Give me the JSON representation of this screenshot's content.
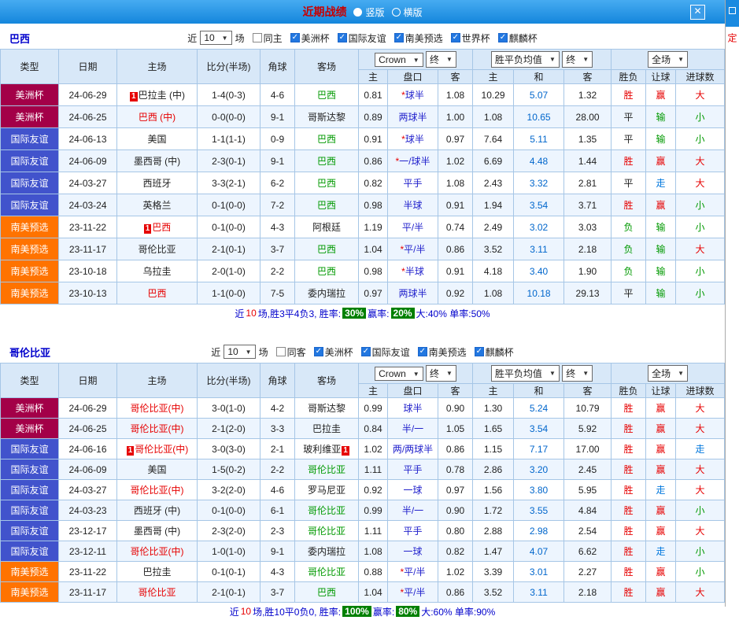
{
  "window": {
    "title": "近期战绩",
    "close": "✕",
    "views": [
      {
        "label": "竖版",
        "state": "on"
      },
      {
        "label": "横版",
        "state": "off"
      }
    ]
  },
  "side_strip": {
    "label": "定"
  },
  "icons": {
    "dropdown_arrow": "▼",
    "checkbox_check": "✓",
    "close": "✕"
  },
  "colors": {
    "accent_blue": "#1486dc",
    "type_copa": "#a30048",
    "type_friendly": "#4153cc",
    "type_sam_qual": "#ff7300",
    "win_red": "#e60000",
    "lose_green": "#009900",
    "push_blue": "#0077dd",
    "badge_green": "#008000"
  },
  "table_headers": {
    "cols": [
      "类型",
      "日期",
      "主场",
      "比分(半场)",
      "角球",
      "客场"
    ],
    "sub": [
      "主",
      "盘口",
      "客",
      "主",
      "和",
      "客",
      "胜负",
      "让球",
      "进球数"
    ]
  },
  "sections": [
    {
      "team": "巴西",
      "filter": {
        "near": "近",
        "count": "10",
        "games": "场",
        "checks": [
          {
            "label": "同主",
            "state": "off"
          },
          {
            "label": "美洲杯",
            "state": "on"
          },
          {
            "label": "国际友谊",
            "state": "on"
          },
          {
            "label": "南美预选",
            "state": "on"
          },
          {
            "label": "世界杯",
            "state": "on"
          },
          {
            "label": "麒麟杯",
            "state": "on"
          }
        ]
      },
      "dropdowns": {
        "source": "Crown",
        "time1": "终",
        "europe": "胜平负均值",
        "time2": "终",
        "scope": "全场"
      },
      "rows": [
        {
          "type": "美洲杯",
          "type_c": "t-copa",
          "date": "24-06-29",
          "hb": "1",
          "home": "巴拉圭 (中)",
          "home_c": "cK",
          "score": "1-4(0-3)",
          "corners": "4-6",
          "away": "巴西",
          "away_c": "cG",
          "o1": "0.81",
          "star": "*",
          "hcap": "球半",
          "o2": "1.08",
          "e1": "10.29",
          "e2": "5.07",
          "e3": "1.32",
          "res": "胜",
          "res_c": "cR",
          "cov": "赢",
          "cov_c": "cR",
          "ou": "大",
          "ou_c": "cR"
        },
        {
          "type": "美洲杯",
          "type_c": "t-copa",
          "date": "24-06-25",
          "home": "巴西 (中)",
          "home_c": "cR",
          "score": "0-0(0-0)",
          "corners": "9-1",
          "away": "哥斯达黎",
          "away_c": "cK",
          "o1": "0.89",
          "hcap": "两球半",
          "o2": "1.00",
          "e1": "1.08",
          "e2": "10.65",
          "e3": "28.00",
          "res": "平",
          "res_c": "cK",
          "cov": "输",
          "cov_c": "cG",
          "ou": "小",
          "ou_c": "cG"
        },
        {
          "type": "国际友谊",
          "type_c": "t-fri",
          "date": "24-06-13",
          "home": "美国",
          "home_c": "cK",
          "score": "1-1(1-1)",
          "corners": "0-9",
          "away": "巴西",
          "away_c": "cG",
          "o1": "0.91",
          "star": "*",
          "hcap": "球半",
          "o2": "0.97",
          "e1": "7.64",
          "e2": "5.11",
          "e3": "1.35",
          "res": "平",
          "res_c": "cK",
          "cov": "输",
          "cov_c": "cG",
          "ou": "小",
          "ou_c": "cG"
        },
        {
          "type": "国际友谊",
          "type_c": "t-fri",
          "date": "24-06-09",
          "home": "墨西哥 (中)",
          "home_c": "cK",
          "score": "2-3(0-1)",
          "corners": "9-1",
          "away": "巴西",
          "away_c": "cG",
          "o1": "0.86",
          "star": "*",
          "hcap": "一/球半",
          "o2": "1.02",
          "e1": "6.69",
          "e2": "4.48",
          "e3": "1.44",
          "res": "胜",
          "res_c": "cR",
          "cov": "赢",
          "cov_c": "cR",
          "ou": "大",
          "ou_c": "cR"
        },
        {
          "type": "国际友谊",
          "type_c": "t-fri",
          "date": "24-03-27",
          "home": "西班牙",
          "home_c": "cK",
          "score": "3-3(2-1)",
          "corners": "6-2",
          "away": "巴西",
          "away_c": "cG",
          "o1": "0.82",
          "hcap": "平手",
          "o2": "1.08",
          "e1": "2.43",
          "e2": "3.32",
          "e3": "2.81",
          "res": "平",
          "res_c": "cK",
          "cov": "走",
          "cov_c": "cB",
          "ou": "大",
          "ou_c": "cR"
        },
        {
          "type": "国际友谊",
          "type_c": "t-fri",
          "date": "24-03-24",
          "home": "英格兰",
          "home_c": "cK",
          "score": "0-1(0-0)",
          "corners": "7-2",
          "away": "巴西",
          "away_c": "cG",
          "o1": "0.98",
          "hcap": "半球",
          "o2": "0.91",
          "e1": "1.94",
          "e2": "3.54",
          "e3": "3.71",
          "res": "胜",
          "res_c": "cR",
          "cov": "赢",
          "cov_c": "cR",
          "ou": "小",
          "ou_c": "cG"
        },
        {
          "type": "南美预选",
          "type_c": "t-sam",
          "date": "23-11-22",
          "hb": "1",
          "home": "巴西",
          "home_c": "cR",
          "score": "0-1(0-0)",
          "corners": "4-3",
          "away": "阿根廷",
          "away_c": "cK",
          "o1": "1.19",
          "hcap": "平/半",
          "o2": "0.74",
          "e1": "2.49",
          "e2": "3.02",
          "e3": "3.03",
          "res": "负",
          "res_c": "cG",
          "cov": "输",
          "cov_c": "cG",
          "ou": "小",
          "ou_c": "cG"
        },
        {
          "type": "南美预选",
          "type_c": "t-sam",
          "date": "23-11-17",
          "home": "哥伦比亚",
          "home_c": "cK",
          "score": "2-1(0-1)",
          "corners": "3-7",
          "away": "巴西",
          "away_c": "cG",
          "o1": "1.04",
          "star": "*",
          "hcap": "平/半",
          "o2": "0.86",
          "e1": "3.52",
          "e2": "3.11",
          "e3": "2.18",
          "res": "负",
          "res_c": "cG",
          "cov": "输",
          "cov_c": "cG",
          "ou": "大",
          "ou_c": "cR"
        },
        {
          "type": "南美预选",
          "type_c": "t-sam",
          "date": "23-10-18",
          "home": "乌拉圭",
          "home_c": "cK",
          "score": "2-0(1-0)",
          "corners": "2-2",
          "away": "巴西",
          "away_c": "cG",
          "o1": "0.98",
          "star": "*",
          "hcap": "半球",
          "o2": "0.91",
          "e1": "4.18",
          "e2": "3.40",
          "e3": "1.90",
          "res": "负",
          "res_c": "cG",
          "cov": "输",
          "cov_c": "cG",
          "ou": "小",
          "ou_c": "cG"
        },
        {
          "type": "南美预选",
          "type_c": "t-sam",
          "date": "23-10-13",
          "home": "巴西",
          "home_c": "cR",
          "score": "1-1(0-0)",
          "corners": "7-5",
          "away": "委内瑞拉",
          "away_c": "cK",
          "o1": "0.97",
          "hcap": "两球半",
          "o2": "0.92",
          "e1": "1.08",
          "e2": "10.18",
          "e3": "29.13",
          "res": "平",
          "res_c": "cK",
          "cov": "输",
          "cov_c": "cG",
          "ou": "小",
          "ou_c": "cG"
        }
      ],
      "summary": {
        "s1": "近",
        "n": "10",
        "s2": "场,胜3平4负3, 胜率:",
        "b1": "30%",
        "s3": "赢率:",
        "b2": "20%",
        "s4": "大:40% 单率:50%"
      }
    },
    {
      "team": "哥伦比亚",
      "filter": {
        "near": "近",
        "count": "10",
        "games": "场",
        "checks": [
          {
            "label": "同客",
            "state": "off"
          },
          {
            "label": "美洲杯",
            "state": "on"
          },
          {
            "label": "国际友谊",
            "state": "on"
          },
          {
            "label": "南美预选",
            "state": "on"
          },
          {
            "label": "麒麟杯",
            "state": "on"
          }
        ]
      },
      "dropdowns": {
        "source": "Crown",
        "time1": "终",
        "europe": "胜平负均值",
        "time2": "终",
        "scope": "全场"
      },
      "rows": [
        {
          "type": "美洲杯",
          "type_c": "t-copa",
          "date": "24-06-29",
          "home": "哥伦比亚(中)",
          "home_c": "cR",
          "score": "3-0(1-0)",
          "corners": "4-2",
          "away": "哥斯达黎",
          "away_c": "cK",
          "o1": "0.99",
          "hcap": "球半",
          "o2": "0.90",
          "e1": "1.30",
          "e2": "5.24",
          "e3": "10.79",
          "res": "胜",
          "res_c": "cR",
          "cov": "赢",
          "cov_c": "cR",
          "ou": "大",
          "ou_c": "cR"
        },
        {
          "type": "美洲杯",
          "type_c": "t-copa",
          "date": "24-06-25",
          "home": "哥伦比亚(中)",
          "home_c": "cR",
          "score": "2-1(2-0)",
          "corners": "3-3",
          "away": "巴拉圭",
          "away_c": "cK",
          "o1": "0.84",
          "hcap": "半/一",
          "o2": "1.05",
          "e1": "1.65",
          "e2": "3.54",
          "e3": "5.92",
          "res": "胜",
          "res_c": "cR",
          "cov": "赢",
          "cov_c": "cR",
          "ou": "大",
          "ou_c": "cR"
        },
        {
          "type": "国际友谊",
          "type_c": "t-fri",
          "date": "24-06-16",
          "hb": "1",
          "home": "哥伦比亚(中)",
          "home_c": "cR",
          "score": "3-0(3-0)",
          "corners": "2-1",
          "away": "玻利维亚",
          "away_c": "cK",
          "ab": "1",
          "o1": "1.02",
          "hcap": "两/两球半",
          "o2": "0.86",
          "e1": "1.15",
          "e2": "7.17",
          "e3": "17.00",
          "res": "胜",
          "res_c": "cR",
          "cov": "赢",
          "cov_c": "cR",
          "ou": "走",
          "ou_c": "cB"
        },
        {
          "type": "国际友谊",
          "type_c": "t-fri",
          "date": "24-06-09",
          "home": "美国",
          "home_c": "cK",
          "score": "1-5(0-2)",
          "corners": "2-2",
          "away": "哥伦比亚",
          "away_c": "cG",
          "o1": "1.11",
          "hcap": "平手",
          "o2": "0.78",
          "e1": "2.86",
          "e2": "3.20",
          "e3": "2.45",
          "res": "胜",
          "res_c": "cR",
          "cov": "赢",
          "cov_c": "cR",
          "ou": "大",
          "ou_c": "cR"
        },
        {
          "type": "国际友谊",
          "type_c": "t-fri",
          "date": "24-03-27",
          "home": "哥伦比亚(中)",
          "home_c": "cR",
          "score": "3-2(2-0)",
          "corners": "4-6",
          "away": "罗马尼亚",
          "away_c": "cK",
          "o1": "0.92",
          "hcap": "一球",
          "o2": "0.97",
          "e1": "1.56",
          "e2": "3.80",
          "e3": "5.95",
          "res": "胜",
          "res_c": "cR",
          "cov": "走",
          "cov_c": "cB",
          "ou": "大",
          "ou_c": "cR"
        },
        {
          "type": "国际友谊",
          "type_c": "t-fri",
          "date": "24-03-23",
          "home": "西班牙 (中)",
          "home_c": "cK",
          "score": "0-1(0-0)",
          "corners": "6-1",
          "away": "哥伦比亚",
          "away_c": "cG",
          "o1": "0.99",
          "hcap": "半/一",
          "o2": "0.90",
          "e1": "1.72",
          "e2": "3.55",
          "e3": "4.84",
          "res": "胜",
          "res_c": "cR",
          "cov": "赢",
          "cov_c": "cR",
          "ou": "小",
          "ou_c": "cG"
        },
        {
          "type": "国际友谊",
          "type_c": "t-fri",
          "date": "23-12-17",
          "home": "墨西哥 (中)",
          "home_c": "cK",
          "score": "2-3(2-0)",
          "corners": "2-3",
          "away": "哥伦比亚",
          "away_c": "cG",
          "o1": "1.11",
          "hcap": "平手",
          "o2": "0.80",
          "e1": "2.88",
          "e2": "2.98",
          "e3": "2.54",
          "res": "胜",
          "res_c": "cR",
          "cov": "赢",
          "cov_c": "cR",
          "ou": "大",
          "ou_c": "cR"
        },
        {
          "type": "国际友谊",
          "type_c": "t-fri",
          "date": "23-12-11",
          "home": "哥伦比亚(中)",
          "home_c": "cR",
          "score": "1-0(1-0)",
          "corners": "9-1",
          "away": "委内瑞拉",
          "away_c": "cK",
          "o1": "1.08",
          "hcap": "一球",
          "o2": "0.82",
          "e1": "1.47",
          "e2": "4.07",
          "e3": "6.62",
          "res": "胜",
          "res_c": "cR",
          "cov": "走",
          "cov_c": "cB",
          "ou": "小",
          "ou_c": "cG"
        },
        {
          "type": "南美预选",
          "type_c": "t-sam",
          "date": "23-11-22",
          "home": "巴拉圭",
          "home_c": "cK",
          "score": "0-1(0-1)",
          "corners": "4-3",
          "away": "哥伦比亚",
          "away_c": "cG",
          "o1": "0.88",
          "star": "*",
          "hcap": "平/半",
          "o2": "1.02",
          "e1": "3.39",
          "e2": "3.01",
          "e3": "2.27",
          "res": "胜",
          "res_c": "cR",
          "cov": "赢",
          "cov_c": "cR",
          "ou": "小",
          "ou_c": "cG"
        },
        {
          "type": "南美预选",
          "type_c": "t-sam",
          "date": "23-11-17",
          "home": "哥伦比亚",
          "home_c": "cR",
          "score": "2-1(0-1)",
          "corners": "3-7",
          "away": "巴西",
          "away_c": "cG",
          "o1": "1.04",
          "star": "*",
          "hcap": "平/半",
          "o2": "0.86",
          "e1": "3.52",
          "e2": "3.11",
          "e3": "2.18",
          "res": "胜",
          "res_c": "cR",
          "cov": "赢",
          "cov_c": "cR",
          "ou": "大",
          "ou_c": "cR"
        }
      ],
      "summary": {
        "s1": "近",
        "n": "10",
        "s2": "场,胜10平0负0, 胜率:",
        "b1": "100%",
        "s3": "赢率:",
        "b2": "80%",
        "s4": "大:60% 单率:90%"
      }
    }
  ]
}
